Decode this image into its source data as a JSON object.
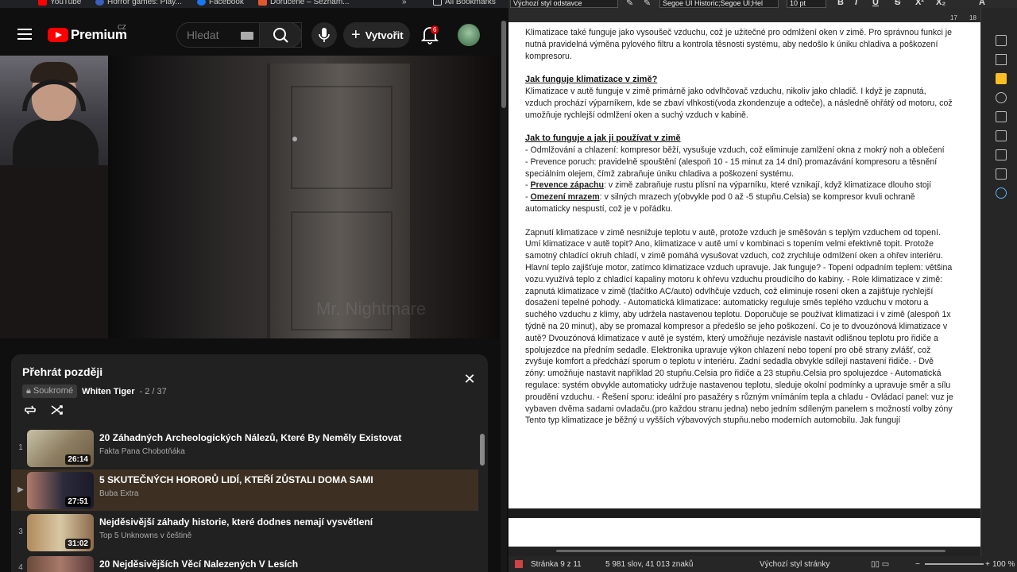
{
  "browser": {
    "bookmarks": [
      "YouTube",
      "Horror games: Play...",
      "Facebook",
      "Doručené – Seznam...",
      "»",
      "All Bookmarks"
    ]
  },
  "youtube": {
    "logo_text": "Premium",
    "region": "CZ",
    "search_placeholder": "Hledat",
    "create_label": "Vytvořit",
    "notification_count": "6",
    "video_watermark": "Mr. Nightmare",
    "playlist": {
      "title": "Přehrát později",
      "privacy": "Soukromé",
      "owner": "Whiten Tiger",
      "position": "- 2 / 37",
      "items": [
        {
          "index": "1",
          "title": "20 Záhadných Archeologických Nálezů, Které By Neměly Existovat",
          "channel": "Fakta Pana Chobotňáka",
          "duration": "26:14"
        },
        {
          "index": "▶",
          "title": "5 SKUTEČNÝCH HORORŮ LIDÍ, KTEŘÍ ZŮSTALI DOMA SAMI",
          "channel": "Buba Extra",
          "duration": "27:51"
        },
        {
          "index": "3",
          "title": "Nejděsivější záhady historie, které dodnes nemají vysvětlení",
          "channel": "Top 5 Unknowns v češtině",
          "duration": "31:02"
        },
        {
          "index": "4",
          "title": "20 Nejděsivějších Věcí Nalezených V Lesích",
          "channel": "",
          "duration": ""
        }
      ]
    }
  },
  "writer": {
    "para_style": "Výchozí styl odstavce",
    "font_name": "Segoe UI Historic;Segoe UI;Hel",
    "font_size": "10 pt",
    "format_buttons": [
      "B",
      "I",
      "U",
      "S",
      "X²",
      "X₂",
      "A"
    ],
    "ruler_numbers": [
      "17",
      "18"
    ],
    "doc": {
      "p1": "Klimatizace také funguje jako vysoušeč vzduchu, což je užitečné pro odmlžení oken v zimě. Pro správnou funkci je nutná pravidelná výměna pylového filtru a kontrola těsnosti systému, aby nedošlo k úniku chladiva a poškození kompresoru.",
      "h2": "Jak funguje klimatizace v zimě?",
      "p2": "Klimatizace v autě funguje v zimě primárně jako odvlhčovač vzduchu, nikoliv jako chladič. I když je zapnutá, vzduch prochází výparníkem, kde se zbaví vlhkosti(voda zkondenzuje a odteče), a následně ohřátý od motoru, což umožňuje rychlejší odmlžení oken a suchý vzduch v kabině.",
      "h3": "Jak to funguje a jak ji používat v zimě",
      "l1": "- Odmlžování a chlazení: kompresor běží, vysušuje vzduch, což eliminuje zamlžení okna z mokrý noh a oblečení",
      "l2": "- Prevence poruch: pravidelně spouštění (alespoň 10 - 15 minut za 14 dní) promazávání kompresoru a těsnění speciálním olejem, čímž zabraňuje úniku chladiva a poškození systému.",
      "l3_label": "Prevence zápachu",
      "l3_rest": ": v zimě zabraňuje rustu plísní na výparníku, které vznikají, když klimatizace dlouho stojí",
      "l4_label": "Omezení mrazem",
      "l4_rest": ": v silných mrazech y(obvykle pod 0 až -5 stupňu.Celsia) se kompresor kvuli ochraně automaticky nespustí, což je v pořádku.",
      "p4": "Zapnutí klimatizace v zimě nesnižuje teplotu v autě, protože vzduch je směšován s teplým vzduchem od topení. Umí klimatizace v autě topit? Ano, klimatizace v autě umí v kombinaci s topením velmi efektivně topit. Protože samotný chladící okruh chladí, v zimě pomáhá vysušovat vzduch, což zrychluje odmlžení oken a ohřev interiéru. Hlavní teplo zajišťuje motor, zatímco klimatizace vzduch upravuje. Jak funguje? - Topení odpadním teplem: většina vozu.využívá teplo z chladící kapaliny motoru k ohřevu vzduchu proudícího do kabiny. - Role klimatizace v zimě: zapnutá klimatizace v zimě (tlačítko AC/auto) odvlhčuje vzduch, což eliminuje rosení oken a zajišťuje rychlejší dosažení tepelné pohody. - Automatická klimatizace: automaticky reguluje směs teplého vzduchu v motoru a suchého vzduchu z klimy, aby udržela nastavenou teplotu. Doporučuje se používat klimatizaci i v zimě (alespoň 1x týdně na 20 minut), aby se promazal kompresor a předešlo se jeho poškození. Co je to dvouzónová klimatizace v autě? Dvouzónová klimatizace v autě je systém, který umožňuje nezávisle nastavit odlišnou teplotu pro řidiče a spolujezdce na předním sedadle. Elektronika upravuje výkon chlazení nebo topení pro obě strany zvlášť, což zvyšuje komfort a předchází sporum o teplotu v interiéru. Zadní sedadla obvykle sdílejí nastavení řidiče. - Dvě zóny: umožňuje nastavit například 20 stupňu.Celsia pro řidiče a 23 stupňu.Celsia pro spolujezdce - Automatická regulace: systém obvykle automaticky udržuje nastavenou teplotu, sleduje okolní podmínky a upravuje směr a sílu proudění vzduchu. - Řešení sporu: ideální pro pasažéry s různým vnímáním tepla a chladu - Ovládací panel: vuz je vybaven dvěma sadami ovladaču.(pro každou stranu jedna) nebo jedním sdíleným panelem s možností volby zóny Tento typ klimatizace je běžný u vyšších výbavových stupňu.nebo moderních automobilu. Jak fungují"
    },
    "status": {
      "page": "Stránka 9 z 11",
      "words": "5 981 slov, 41 013 znaků",
      "page_style": "Výchozí styl stránky",
      "zoom": "100 %"
    }
  }
}
